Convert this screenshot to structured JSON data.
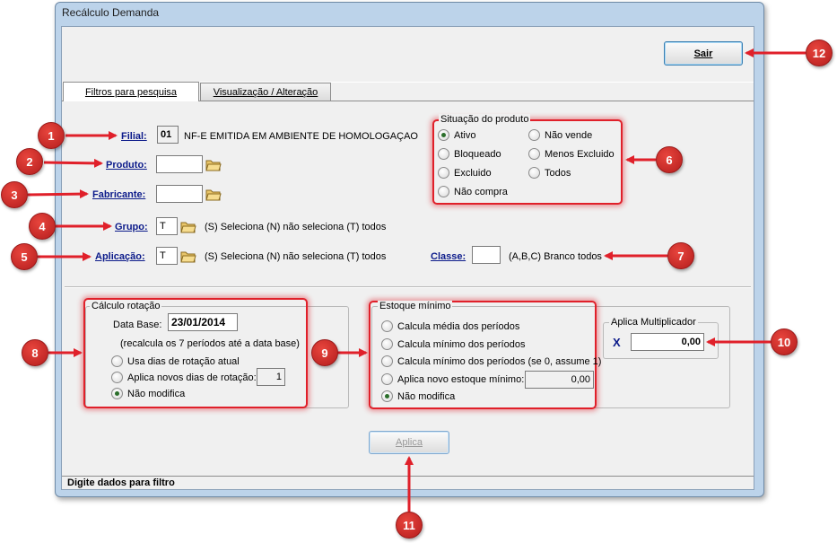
{
  "window": {
    "title": "Recálculo Demanda"
  },
  "toolbar": {
    "sair_label": "Sair",
    "aplica_label": "Aplica"
  },
  "tabs": [
    {
      "label": "Filtros para pesquisa"
    },
    {
      "label": "Visualização / Alteração"
    }
  ],
  "filters": {
    "filial": {
      "label": "Filial:",
      "value": "01",
      "description": "NF-E EMITIDA EM AMBIENTE DE HOMOLOGAÇAO"
    },
    "produto": {
      "label": "Produto:",
      "value": ""
    },
    "fabricante": {
      "label": "Fabricante:",
      "value": ""
    },
    "grupo": {
      "label": "Grupo:",
      "value": "T",
      "hint": "(S) Seleciona (N) não seleciona (T) todos"
    },
    "aplicacao": {
      "label": "Aplicação:",
      "value": "T",
      "hint": "(S) Seleciona (N) não seleciona (T) todos"
    },
    "classe": {
      "label": "Classe:",
      "value": "",
      "hint": "(A,B,C) Branco todos"
    }
  },
  "situacao": {
    "legend": "Situação do produto",
    "options": [
      "Ativo",
      "Bloqueado",
      "Excluido",
      "Não compra",
      "Não vende",
      "Menos Excluido",
      "Todos"
    ],
    "selected": "Ativo"
  },
  "calculo": {
    "legend": "Cálculo rotação",
    "data_base_label": "Data Base:",
    "data_base": "23/01/2014",
    "note": "(recalcula os 7 períodos até a data base)",
    "options": [
      "Usa dias de rotação atual",
      "Aplica novos dias de rotação:",
      "Não modifica"
    ],
    "dias_value": "1",
    "selected": "Não modifica"
  },
  "estoque": {
    "legend": "Estoque mínimo",
    "options": [
      "Calcula média dos períodos",
      "Calcula mínimo dos períodos",
      "Calcula mínimo dos períodos (se 0, assume 1)",
      "Aplica novo estoque mínimo:",
      "Não modifica"
    ],
    "novo_value": "0,00",
    "selected": "Não modifica"
  },
  "multiplicador": {
    "legend": "Aplica Multiplicador",
    "symbol": "X",
    "value": "0,00"
  },
  "status": {
    "text": "Digite dados para filtro"
  },
  "badges": [
    "1",
    "2",
    "3",
    "4",
    "5",
    "6",
    "7",
    "8",
    "9",
    "10",
    "11",
    "12"
  ],
  "colors": {
    "accent_red": "#e0202a",
    "label_blue": "#0b1a8a",
    "window_frame": "#bcd3ea"
  }
}
